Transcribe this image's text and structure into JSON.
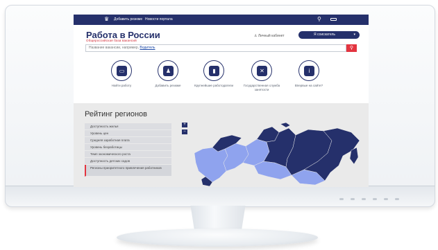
{
  "site": {
    "topbar": {
      "add_resume": "Добавить резюме",
      "portal_news": "Новости портала"
    },
    "logo": {
      "title": "Работа в России",
      "subtitle": "Общероссийская база вакансий"
    },
    "header": {
      "personal_cabinet": "Личный кабинет",
      "role_button": "Я соискатель"
    },
    "search": {
      "placeholder": "Название вакансии, например,",
      "example": "Водитель"
    },
    "services": [
      {
        "label": "Найти работу",
        "icon": "briefcase-icon"
      },
      {
        "label": "Добавить резюме",
        "icon": "resume-icon"
      },
      {
        "label": "Крупнейшие работодатели",
        "icon": "employers-icon"
      },
      {
        "label": "Государственная служба занятости",
        "icon": "hammer-wrench-icon"
      },
      {
        "label": "Впервые на сайте?",
        "icon": "info-icon"
      }
    ],
    "rating": {
      "title": "Рейтинг регионов",
      "menu": [
        "Доступность жилья",
        "Уровень цен",
        "Средняя заработная плата",
        "Уровень безработицы",
        "Темп экономического роста",
        "Доступность детских садов",
        "Регионы приоритетного привлечения работников"
      ],
      "active_index": 6,
      "zoom_in": "+",
      "zoom_out": "−"
    }
  },
  "colors": {
    "brand_navy": "#25306b",
    "accent_red": "#e3343f",
    "map_light": "#8fa3ee",
    "map_dark": "#25306b"
  }
}
